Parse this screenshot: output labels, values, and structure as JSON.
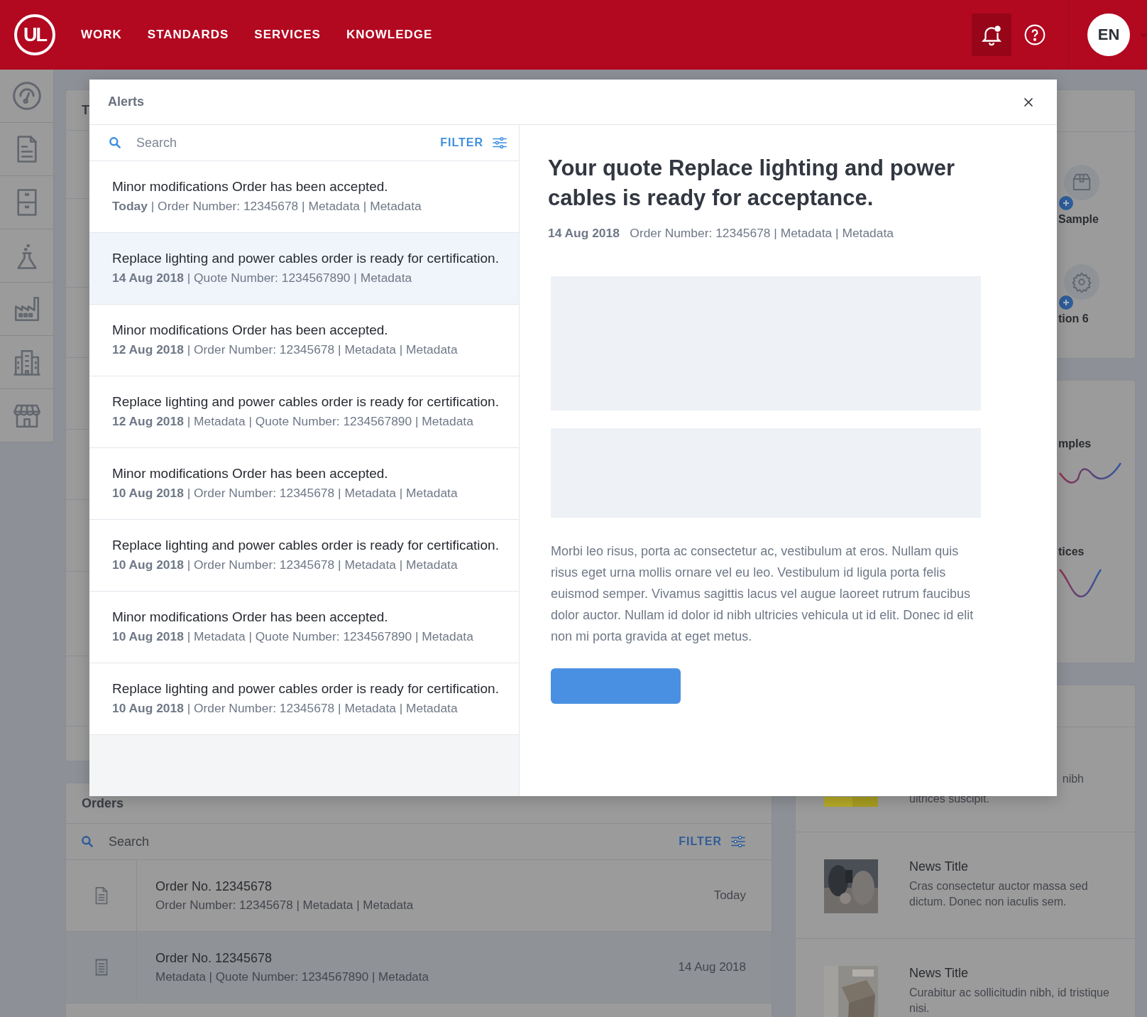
{
  "header": {
    "logo": "UL",
    "nav": [
      {
        "label": "WORK"
      },
      {
        "label": "STANDARDS"
      },
      {
        "label": "SERVICES"
      },
      {
        "label": "KNOWLEDGE"
      }
    ],
    "notifications": {
      "unread": true
    },
    "language": "EN"
  },
  "background": {
    "top_card": {
      "title": "T"
    },
    "quick_actions": [
      {
        "kind": "box",
        "label": "Sample"
      },
      {
        "kind": "gear",
        "label": "tion 6"
      }
    ],
    "trends": [
      {
        "label": "mples",
        "kind": "wave"
      },
      {
        "label": "tices",
        "kind": "dip"
      }
    ],
    "news_fragment": {
      "text": "nibh",
      "line": "ultrices suscipit."
    },
    "news": [
      {
        "title": "News Title",
        "text": "Cras consectetur auctor massa sed dictum. Donec non iaculis sem."
      },
      {
        "title": "News Title",
        "text": "Curabitur ac sollicitudin nibh, id tristique nisi."
      }
    ],
    "orders": {
      "title": "Orders",
      "search": {
        "placeholder": "Search"
      },
      "filter": "FILTER",
      "rows": [
        {
          "kind": "document",
          "title": "Order No. 12345678",
          "meta": "Order Number: 12345678 | Metadata | Metadata",
          "date": "Today",
          "selected": false
        },
        {
          "kind": "receipt",
          "title": "Order No. 12345678",
          "meta": "Metadata | Quote Number: 1234567890 | Metadata",
          "date": "14 Aug 2018",
          "selected": true
        }
      ]
    }
  },
  "modal": {
    "title": "Alerts",
    "search": {
      "placeholder": "Search"
    },
    "filter": "FILTER",
    "alerts": [
      {
        "title": "Minor modifications Order has been accepted.",
        "meta": "**Today** | Order Number: 12345678 | Metadata | Metadata",
        "selected": false
      },
      {
        "title": "Replace lighting and power cables order is ready for certification.",
        "meta": "**14 Aug 2018** | Quote Number: 1234567890 | Metadata",
        "selected": true
      },
      {
        "title": "Minor modifications Order has been accepted.",
        "meta": "**12 Aug 2018** | Order Number: 12345678 | Metadata | Metadata",
        "selected": false
      },
      {
        "title": "Replace lighting and power cables order is ready for certification.",
        "meta": "**12 Aug 2018** | Metadata | Quote Number: 1234567890 | Metadata",
        "selected": false
      },
      {
        "title": "Minor modifications Order has been accepted.",
        "meta": "**10 Aug 2018** | Order Number: 12345678 | Metadata | Metadata",
        "selected": false
      },
      {
        "title": "Replace lighting and power cables order is ready for certification.",
        "meta": "**10 Aug 2018** | Order Number: 12345678 | Metadata | Metadata",
        "selected": false
      },
      {
        "title": "Minor modifications Order has been accepted.",
        "meta": "**10 Aug 2018** | Metadata | Quote Number: 1234567890 | Metadata",
        "selected": false
      },
      {
        "title": "Replace lighting and power cables order is ready for certification.",
        "meta": "**10 Aug 2018** | Order Number: 12345678 | Metadata | Metadata",
        "selected": false
      }
    ],
    "detail": {
      "title": "Your quote Replace lighting and power cables is ready for acceptance.",
      "meta": "**14 Aug 2018**   Order Number: 12345678 | Metadata | Metadata",
      "body": "Morbi leo risus, porta ac consectetur ac, vestibulum at eros. Nullam quis risus eget urna mollis ornare vel eu leo. Vestibulum id ligula porta felis euismod semper. Vivamus sagittis lacus vel augue laoreet rutrum faucibus dolor auctor. Nullam id dolor id nibh ultricies vehicula ut id elit. Donec id elit non mi porta gravida at eget metus."
    }
  }
}
